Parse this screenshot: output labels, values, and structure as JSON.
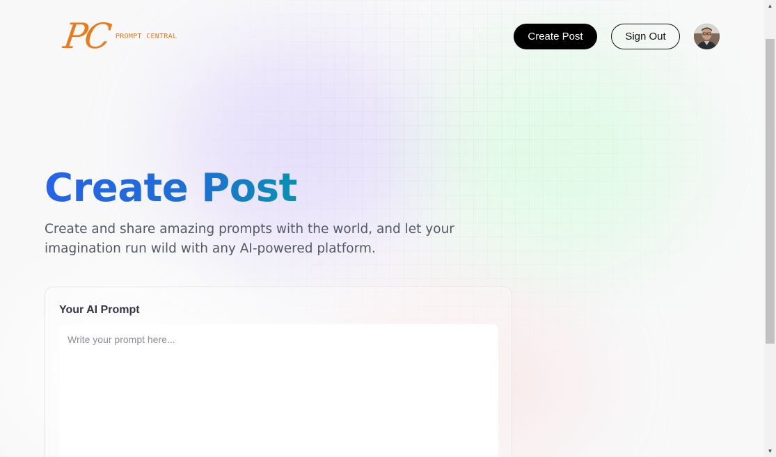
{
  "header": {
    "logo_mark": "PC",
    "logo_text": "PROMPT CENTRAL",
    "create_post_label": "Create Post",
    "sign_out_label": "Sign Out"
  },
  "hero": {
    "title": "Create Post",
    "subtitle": "Create and share amazing prompts with the world, and let your imagination run wild with any AI-powered platform."
  },
  "form": {
    "prompt_label": "Your AI Prompt",
    "prompt_value": "",
    "prompt_placeholder": "Write your prompt here..."
  },
  "colors": {
    "brand_orange": "#ea7a1a",
    "title_gradient_start": "#2563eb",
    "title_gradient_end": "#0891b2",
    "primary_button": "#000000"
  },
  "icons": {
    "avatar": "user-avatar-photo",
    "scroll_up": "scroll-up-arrow-icon",
    "scroll_down": "scroll-down-arrow-icon"
  }
}
